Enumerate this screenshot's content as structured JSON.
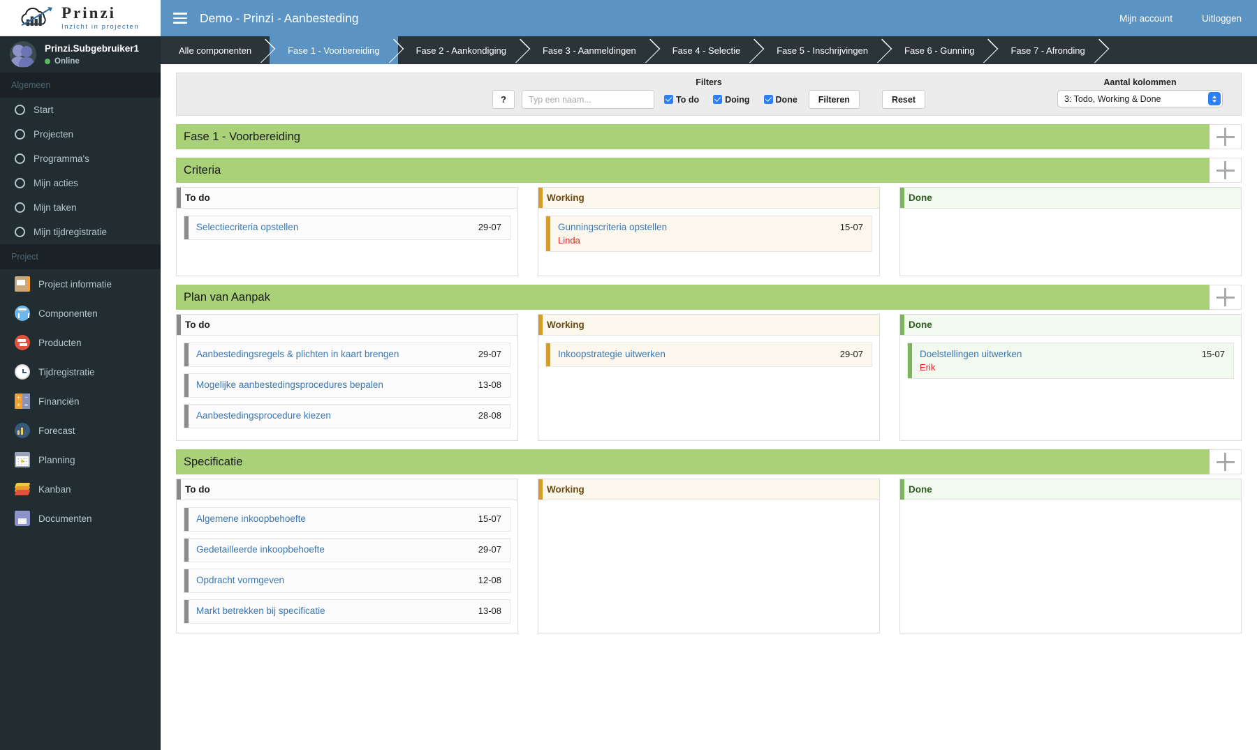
{
  "brand": {
    "title": "Prinzi",
    "subtitle": "Inzicht in projecten",
    "logo_icon": "cloud-bar-chart-logo"
  },
  "user": {
    "name": "Prinzi.Subgebruiker1",
    "status": "Online",
    "avatar_icon": "users-avatar"
  },
  "sidebar": {
    "sections": [
      {
        "header": "Algemeen",
        "items": [
          {
            "label": "Start",
            "icon": "circle-icon"
          },
          {
            "label": "Projecten",
            "icon": "circle-icon"
          },
          {
            "label": "Programma's",
            "icon": "circle-icon"
          },
          {
            "label": "Mijn acties",
            "icon": "circle-icon"
          },
          {
            "label": "Mijn taken",
            "icon": "circle-icon"
          },
          {
            "label": "Mijn tijdregistratie",
            "icon": "circle-icon"
          }
        ]
      },
      {
        "header": "Project",
        "items": [
          {
            "label": "Project informatie",
            "icon": "notebook-icon"
          },
          {
            "label": "Componenten",
            "icon": "network-icon"
          },
          {
            "label": "Producten",
            "icon": "products-icon"
          },
          {
            "label": "Tijdregistratie",
            "icon": "stopwatch-icon"
          },
          {
            "label": "Financiën",
            "icon": "calculator-icon"
          },
          {
            "label": "Forecast",
            "icon": "chart-up-icon"
          },
          {
            "label": "Planning",
            "icon": "calendar-icon"
          },
          {
            "label": "Kanban",
            "icon": "layers-icon"
          },
          {
            "label": "Documenten",
            "icon": "folder-icon"
          }
        ]
      }
    ]
  },
  "topbar": {
    "menu_icon": "hamburger-icon",
    "title": "Demo - Prinzi - Aanbesteding",
    "account_label": "Mijn account",
    "logout_label": "Uitloggen"
  },
  "phases": [
    {
      "label": "Alle componenten",
      "active": false
    },
    {
      "label": "Fase 1 - Voorbereiding",
      "active": true
    },
    {
      "label": "Fase 2 - Aankondiging",
      "active": false
    },
    {
      "label": "Fase 3 - Aanmeldingen",
      "active": false
    },
    {
      "label": "Fase 4 - Selectie",
      "active": false
    },
    {
      "label": "Fase 5 - Inschrijvingen",
      "active": false
    },
    {
      "label": "Fase 6 - Gunning",
      "active": false
    },
    {
      "label": "Fase 7 - Afronding",
      "active": false
    }
  ],
  "filters": {
    "title": "Filters",
    "help_label": "?",
    "name_placeholder": "Typ een naam...",
    "name_value": "",
    "checkboxes": [
      {
        "label": "To do",
        "checked": true
      },
      {
        "label": "Doing",
        "checked": true
      },
      {
        "label": "Done",
        "checked": true
      }
    ],
    "filter_button": "Filteren",
    "reset_button": "Reset",
    "columns_label": "Aantal kolommen",
    "columns_value": "3: Todo, Working & Done"
  },
  "board": {
    "phase_header": "Fase 1 - Voorbereiding",
    "column_labels": {
      "todo": "To do",
      "working": "Working",
      "done": "Done"
    },
    "add_icon": "plus-icon",
    "groups": [
      {
        "title": "Criteria",
        "todo": [
          {
            "title": "Selectiecriteria opstellen",
            "date": "29-07",
            "assignee": ""
          }
        ],
        "working": [
          {
            "title": "Gunningscriteria opstellen",
            "date": "15-07",
            "assignee": "Linda"
          }
        ],
        "done": []
      },
      {
        "title": "Plan van Aanpak",
        "todo": [
          {
            "title": "Aanbestedingsregels & plichten in kaart brengen",
            "date": "29-07",
            "assignee": ""
          },
          {
            "title": "Mogelijke aanbestedingsprocedures bepalen",
            "date": "13-08",
            "assignee": ""
          },
          {
            "title": "Aanbestedingsprocedure kiezen",
            "date": "28-08",
            "assignee": ""
          }
        ],
        "working": [
          {
            "title": "Inkoopstrategie uitwerken",
            "date": "29-07",
            "assignee": ""
          }
        ],
        "done": [
          {
            "title": "Doelstellingen uitwerken",
            "date": "15-07",
            "assignee": "Erik"
          }
        ]
      },
      {
        "title": "Specificatie",
        "todo": [
          {
            "title": "Algemene inkoopbehoefte",
            "date": "15-07",
            "assignee": ""
          },
          {
            "title": "Gedetailleerde inkoopbehoefte",
            "date": "29-07",
            "assignee": ""
          },
          {
            "title": "Opdracht vormgeven",
            "date": "12-08",
            "assignee": ""
          },
          {
            "title": "Markt betrekken bij specificatie",
            "date": "13-08",
            "assignee": ""
          }
        ],
        "working": [],
        "done": []
      }
    ]
  },
  "colors": {
    "topbar": "#5b93c2",
    "sidebar": "#222d32",
    "group_header": "#a9d177",
    "link": "#3b77b0",
    "assignee": "#d9231e",
    "todo_accent": "#8a8a8a",
    "working_accent": "#d79b27",
    "done_accent": "#7cb45b"
  }
}
